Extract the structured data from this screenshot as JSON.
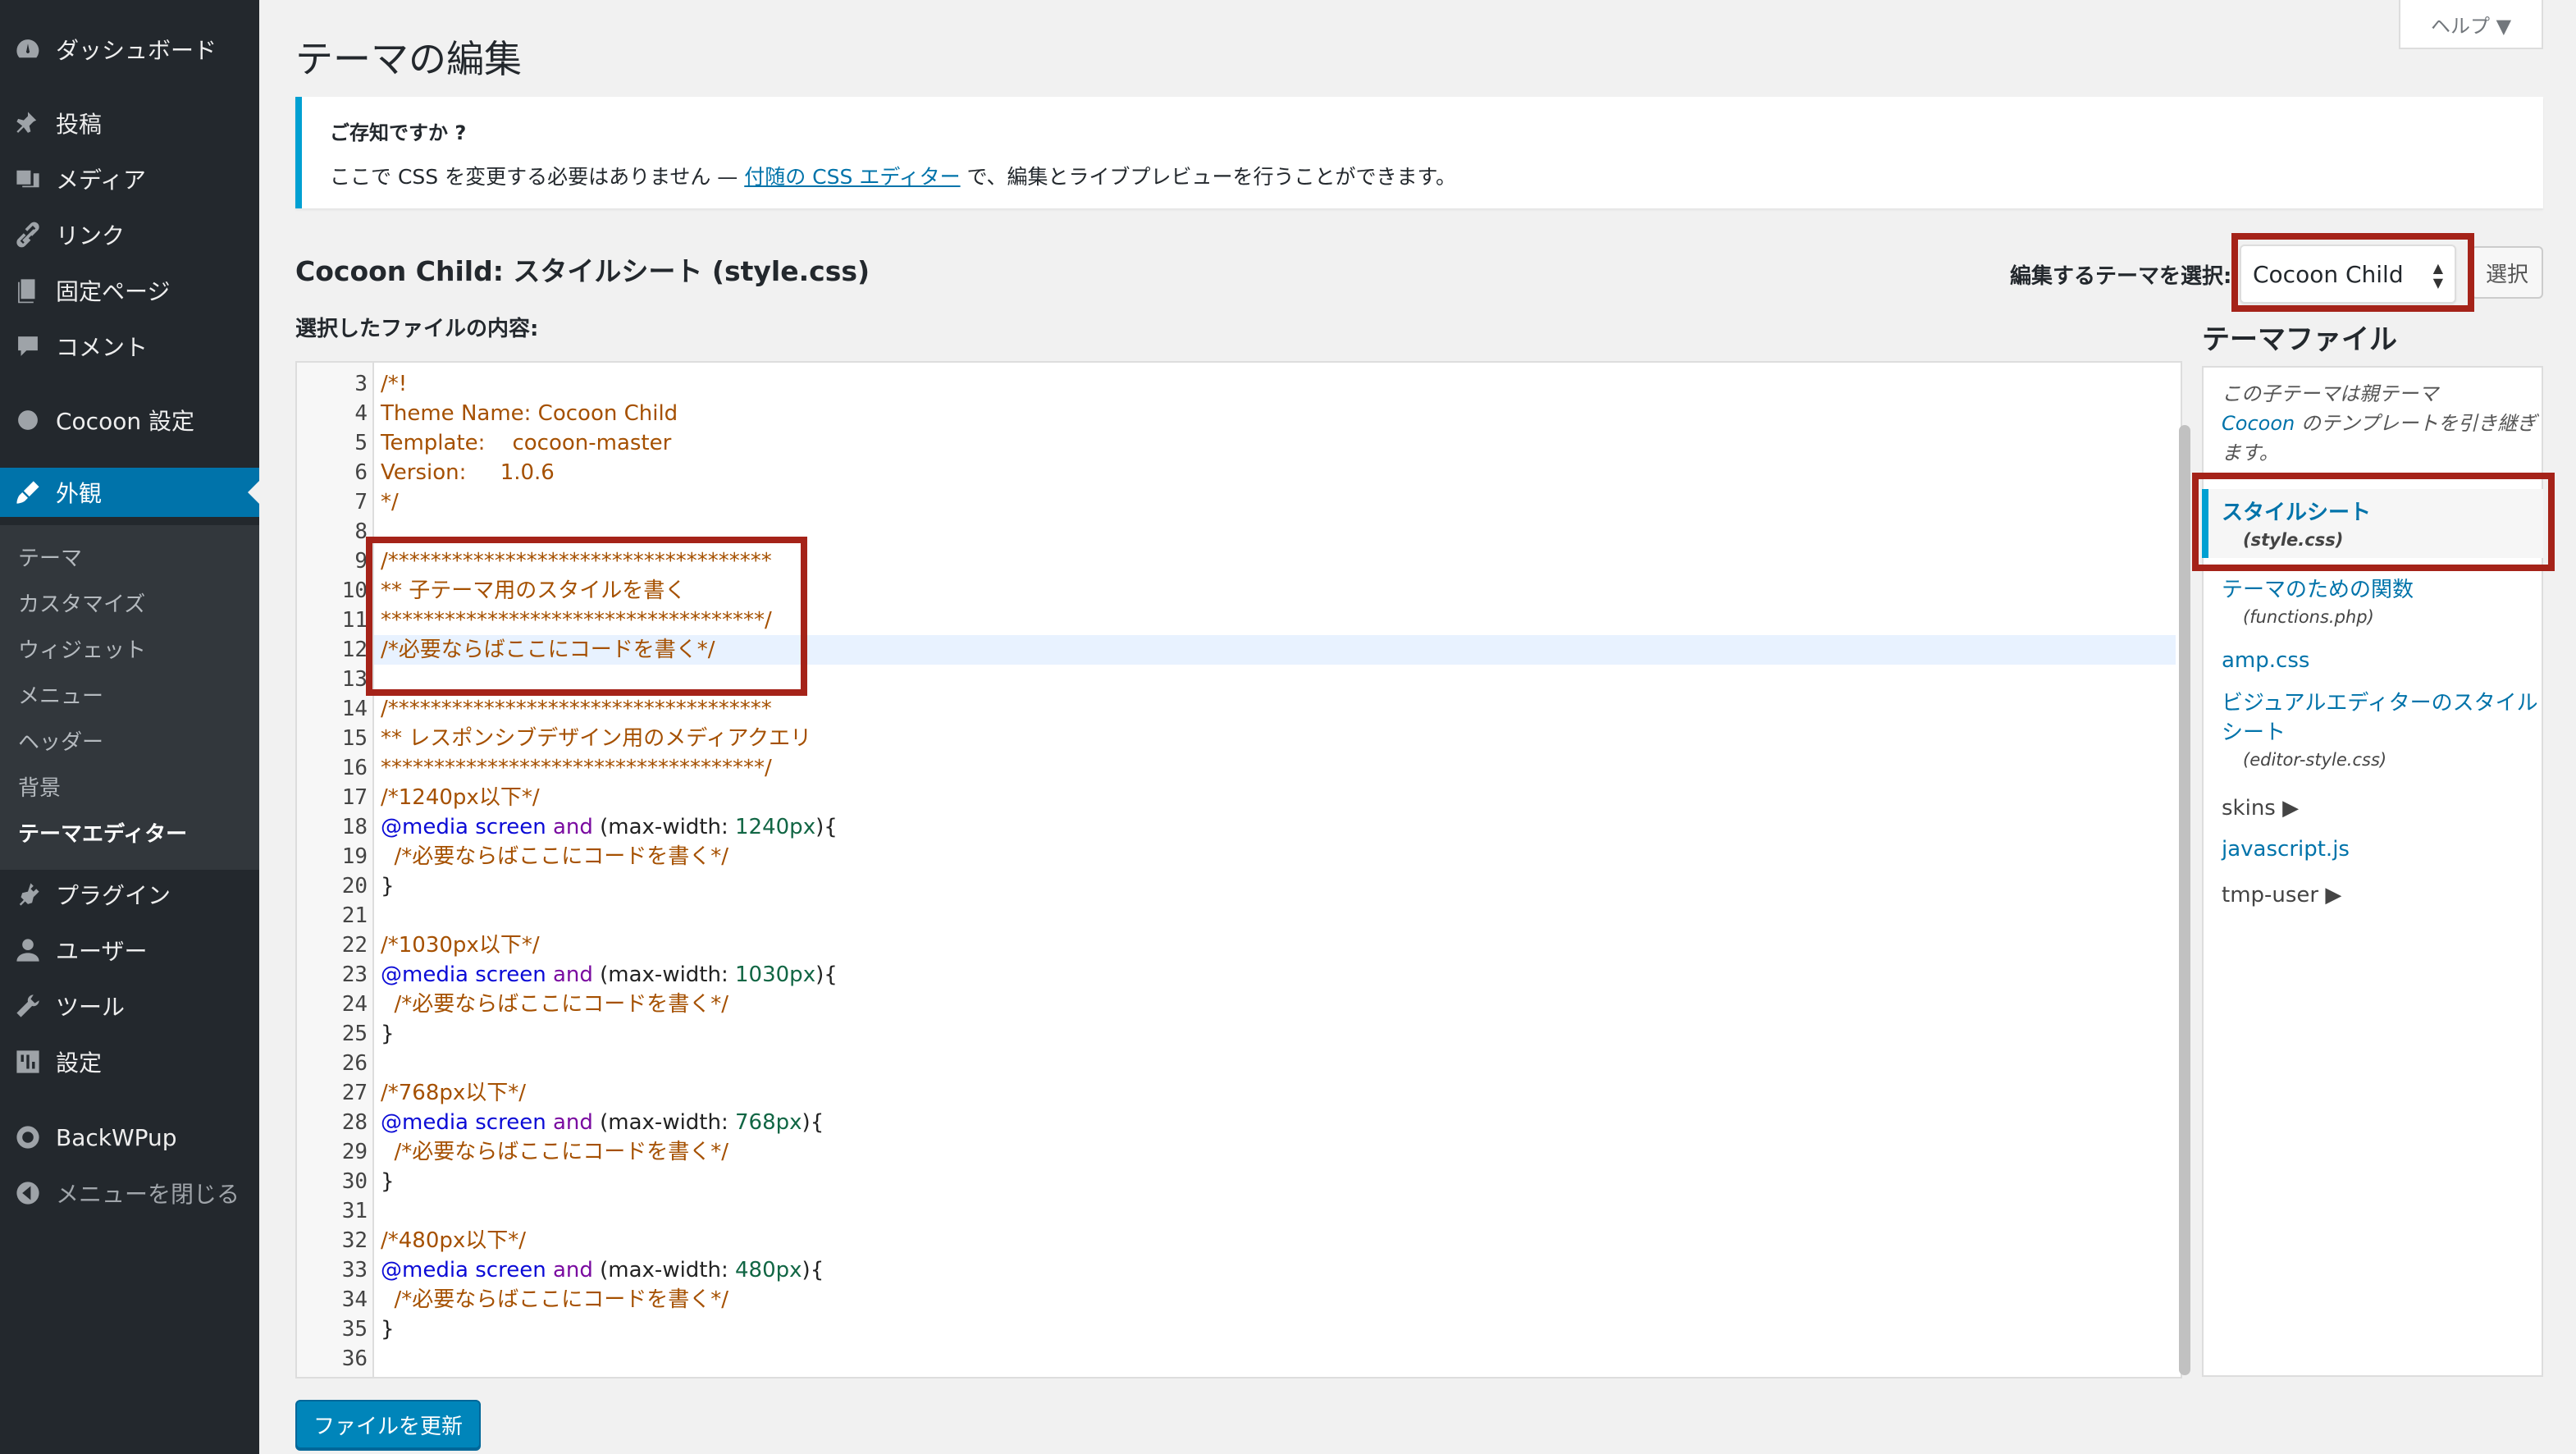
{
  "sidebar": {
    "items": [
      {
        "label": "ダッシュボード",
        "icon": "dashboard-icon"
      },
      {
        "label": "投稿",
        "icon": "pin-icon"
      },
      {
        "label": "メディア",
        "icon": "media-icon"
      },
      {
        "label": "リンク",
        "icon": "link-icon"
      },
      {
        "label": "固定ページ",
        "icon": "page-icon"
      },
      {
        "label": "コメント",
        "icon": "comment-icon"
      },
      {
        "label": "Cocoon 設定",
        "icon": "circle-icon"
      },
      {
        "label": "外観",
        "icon": "brush-icon"
      },
      {
        "label": "プラグイン",
        "icon": "plugin-icon"
      },
      {
        "label": "ユーザー",
        "icon": "user-icon"
      },
      {
        "label": "ツール",
        "icon": "wrench-icon"
      },
      {
        "label": "設定",
        "icon": "settings-icon"
      },
      {
        "label": "BackWPup",
        "icon": "backwpup-icon"
      },
      {
        "label": "メニューを閉じる",
        "icon": "collapse-icon"
      }
    ],
    "submenu": [
      "テーマ",
      "カスタマイズ",
      "ウィジェット",
      "メニュー",
      "ヘッダー",
      "背景",
      "テーマエディター"
    ]
  },
  "help": {
    "label": "ヘルプ ▼"
  },
  "page": {
    "title": "テーマの編集"
  },
  "notice": {
    "title": "ご存知ですか ?",
    "before": "ここで CSS を変更する必要はありません — ",
    "link": "付随の CSS エディター",
    "after": " で、編集とライブプレビューを行うことができます。"
  },
  "file_heading": "Cocoon Child: スタイルシート (style.css)",
  "theme_select": {
    "label": "編集するテーマを選択:",
    "value": "Cocoon Child",
    "button": "選択"
  },
  "content_label": "選択したファイルの内容:",
  "editor": {
    "line_numbers": [
      "3",
      "4",
      "5",
      "6",
      "7",
      "8",
      "9",
      "10",
      "11",
      "12",
      "13",
      "14",
      "15",
      "16",
      "17",
      "18",
      "19",
      "20",
      "21",
      "22",
      "23",
      "24",
      "25",
      "26",
      "27",
      "28",
      "29",
      "30",
      "31",
      "32",
      "33",
      "34",
      "35",
      "36"
    ],
    "lines": {
      "l3": "/*!",
      "l4": "Theme Name: Cocoon Child",
      "l5": "Template:    cocoon-master",
      "l6": "Version:     1.0.6",
      "l7": "*/",
      "l9": "/************************************",
      "l10": "** 子テーマ用のスタイルを書く",
      "l11": "************************************/",
      "l12": "/*必要ならばここにコードを書く*/",
      "l14": "/************************************",
      "l15": "** レスポンシブデザイン用のメディアクエリ",
      "l16": "************************************/",
      "l17": "/*1240px以下*/",
      "at": "@media",
      "screen": "screen",
      "and": "and",
      "mw": "(max-width: ",
      "v1240": "1240px",
      "v1030": "1030px",
      "v768": "768px",
      "v480": "480px",
      "close_paren": "){",
      "inner": "  /*必要ならばここにコードを書く*/",
      "brace": "}",
      "l22": "/*1030px以下*/",
      "l27": "/*768px以下*/",
      "l32": "/*480px以下*/"
    }
  },
  "theme_files": {
    "heading": "テーマファイル",
    "note_before": "この子テーマは親テーマ",
    "note_link": "Cocoon",
    "note_after": " のテンプレートを引き継ぎます。",
    "files": [
      {
        "label": "スタイルシート",
        "sub": "(style.css)"
      },
      {
        "label": "テーマのための関数",
        "sub": "(functions.php)"
      },
      {
        "label": "amp.css"
      },
      {
        "label": "ビジュアルエディターのスタイル",
        "label2": "シート",
        "sub": "(editor-style.css)"
      },
      {
        "label": "skins ▶"
      },
      {
        "label": "javascript.js"
      },
      {
        "label": "tmp-user ▶"
      }
    ]
  },
  "update_button": "ファイルを更新"
}
